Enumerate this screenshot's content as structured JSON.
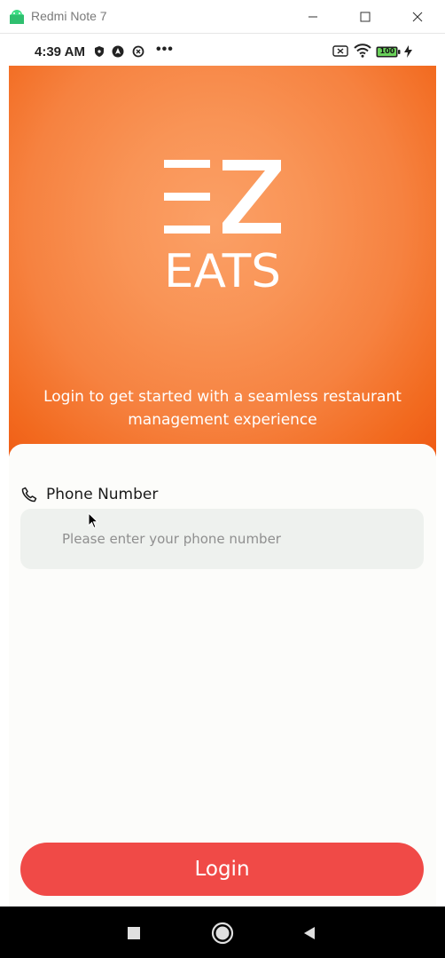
{
  "window": {
    "title": "Redmi Note 7"
  },
  "statusbar": {
    "time": "4:39 AM",
    "dots": "•••",
    "battery": "100"
  },
  "hero": {
    "logo_text": "EATS",
    "tagline": "Login to get started with a seamless restaurant management experience"
  },
  "form": {
    "phone_label": "Phone Number",
    "phone_placeholder": "Please enter your phone number",
    "phone_value": ""
  },
  "login_button": {
    "label": "Login"
  },
  "colors": {
    "accent": "#f04a47",
    "hero_orange": "#f68240",
    "input_bg": "#eef1ee"
  }
}
